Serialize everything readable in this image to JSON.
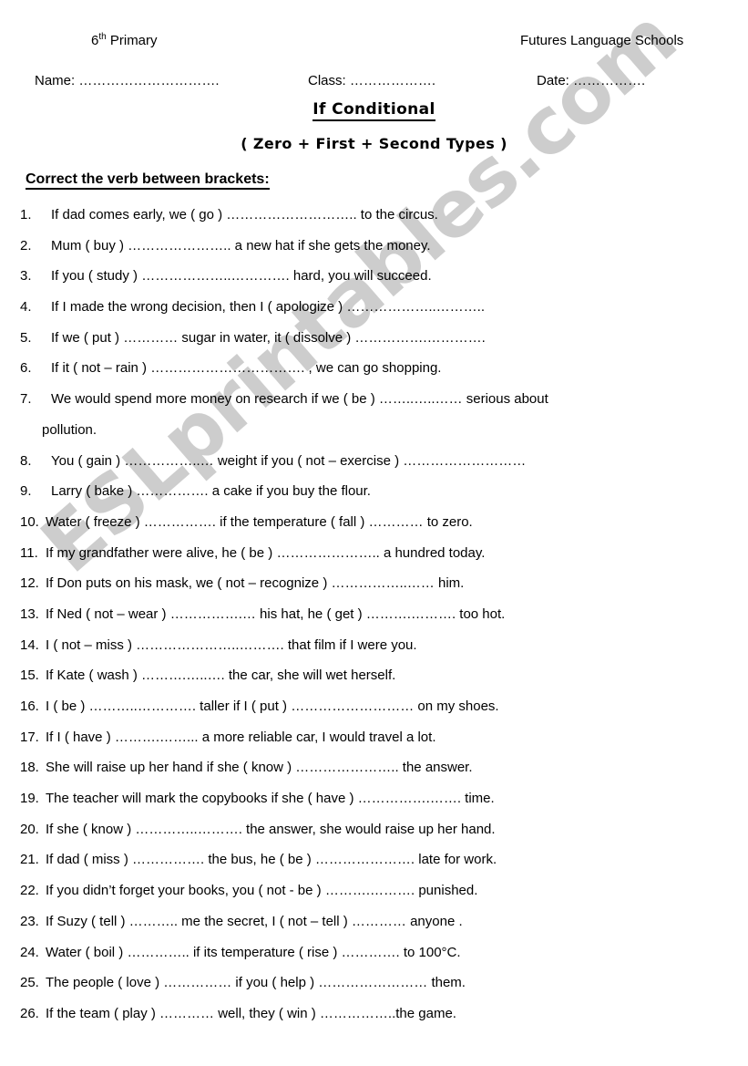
{
  "header": {
    "grade_number": "6",
    "grade_sup": "th",
    "grade_suffix": " Primary",
    "school": "Futures Language Schools",
    "name_field": "Name: ………………………….",
    "class_field": "Class: ……………….",
    "date_field": "Date: ……………."
  },
  "title": "If Conditional",
  "subtitle": "( Zero + First + Second Types )",
  "instruction": "Correct the verb between brackets:",
  "watermark": "ESLprintables.com",
  "watermark_color": "#cdcdcd",
  "questions": [
    {
      "num": "1.",
      "text": "If dad comes early, we ( go ) ……………………….. to the circus."
    },
    {
      "num": "2.",
      "text": "Mum ( buy ) ………………….. a new hat if she gets the money."
    },
    {
      "num": "3.",
      "text": "If you ( study ) ………………..…………. hard, you will succeed."
    },
    {
      "num": "4.",
      "text": "If I made the wrong decision, then I ( apologize ) ………………..……….."
    },
    {
      "num": "5.",
      "text": "If we ( put ) …………  sugar in water, it ( dissolve ) …………….…………."
    },
    {
      "num": "6.",
      "text": "If it ( not – rain ) ……………………………. , we can go shopping."
    },
    {
      "num": "7.",
      "text": "We would spend more money on research if we ( be ) ……..…..…… serious about",
      "continuation": "pollution."
    },
    {
      "num": "8.",
      "text": "You ( gain ) ……………..… weight if you ( not – exercise ) ………………………"
    },
    {
      "num": "9.",
      "text": "Larry ( bake ) ……………. a cake if you  buy the flour."
    },
    {
      "num": "10.",
      "text": "Water ( freeze ) ……………. if the temperature ( fall ) ………… to zero."
    },
    {
      "num": "11.",
      "text": "If my grandfather were alive, he ( be ) ………………….. a hundred today."
    },
    {
      "num": "12.",
      "text": "If Don puts on his mask, we ( not – recognize ) ……………..…… him."
    },
    {
      "num": "13.",
      "text": "If Ned ( not – wear ) …………….… his hat, he ( get ) ……….………. too hot."
    },
    {
      "num": "14.",
      "text": "I ( not – miss ) …………………..………. that film if I were you."
    },
    {
      "num": "15.",
      "text": "If Kate ( wash ) ……….…..…. the car, she will wet herself."
    },
    {
      "num": "16.",
      "text": "I ( be ) ………..…………. taller if I ( put ) ……………………… on my shoes."
    },
    {
      "num": "17.",
      "text": "If I ( have ) ……….……... a more reliable car, I would travel a lot."
    },
    {
      "num": "18.",
      "text": "She will raise up  her hand if she ( know ) ………………….. the answer."
    },
    {
      "num": "19.",
      "text": "The teacher will mark the copybooks if she ( have ) …………….……. time."
    },
    {
      "num": "20.",
      "text": "If she ( know ) …………..………. the answer, she would raise up her hand."
    },
    {
      "num": "21.",
      "text": "If dad ( miss ) ……………. the bus, he ( be ) …………………. late for work."
    },
    {
      "num": "22.",
      "text": "If you didn’t forget your books, you ( not - be ) ……….………. punished."
    },
    {
      "num": "23.",
      "text": "If Suzy ( tell ) ……….. me the secret, I ( not – tell ) ………… anyone ."
    },
    {
      "num": "24.",
      "text": "Water ( boil ) ………….. if its temperature ( rise ) …………. to 100°C."
    },
    {
      "num": "25.",
      "text": "The people ( love ) …………… if you ( help ) …………………… them."
    },
    {
      "num": "26.",
      "text": "If the team ( play ) ………… well, they ( win ) ……………..the game."
    }
  ]
}
